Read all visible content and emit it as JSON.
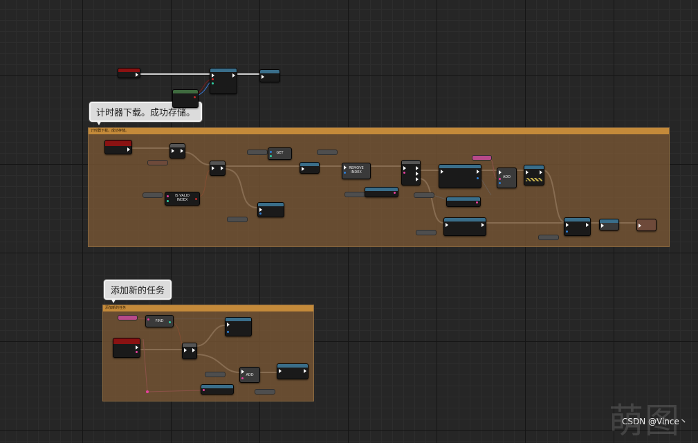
{
  "editor": {
    "comment_1": {
      "bubble_text": "计时器下载。成功存储。",
      "header_text": "计时器下载。成功存储。"
    },
    "comment_2": {
      "bubble_text": "添加新的任务",
      "header_text": "添加新的任务"
    }
  },
  "nodes": {
    "get": "GET",
    "remove_index": "REMOVE\nINDEX",
    "is_valid_index": "IS VALID\nINDEX",
    "add_1": "ADD",
    "find": "FIND",
    "add_2": "ADD"
  },
  "watermark": "萌图",
  "credit": "CSDN @Vince丶",
  "colors": {
    "exec": "#ffffff",
    "event_header": "#8a1212",
    "function_header": "#3a6e8a",
    "pure_header": "#3f6a3f",
    "array_pin": "#e8409e",
    "object_pin": "#2f7fd6",
    "int_pin": "#2fd1a3",
    "comment_body": "#765634",
    "comment_header": "#c48a3a"
  }
}
